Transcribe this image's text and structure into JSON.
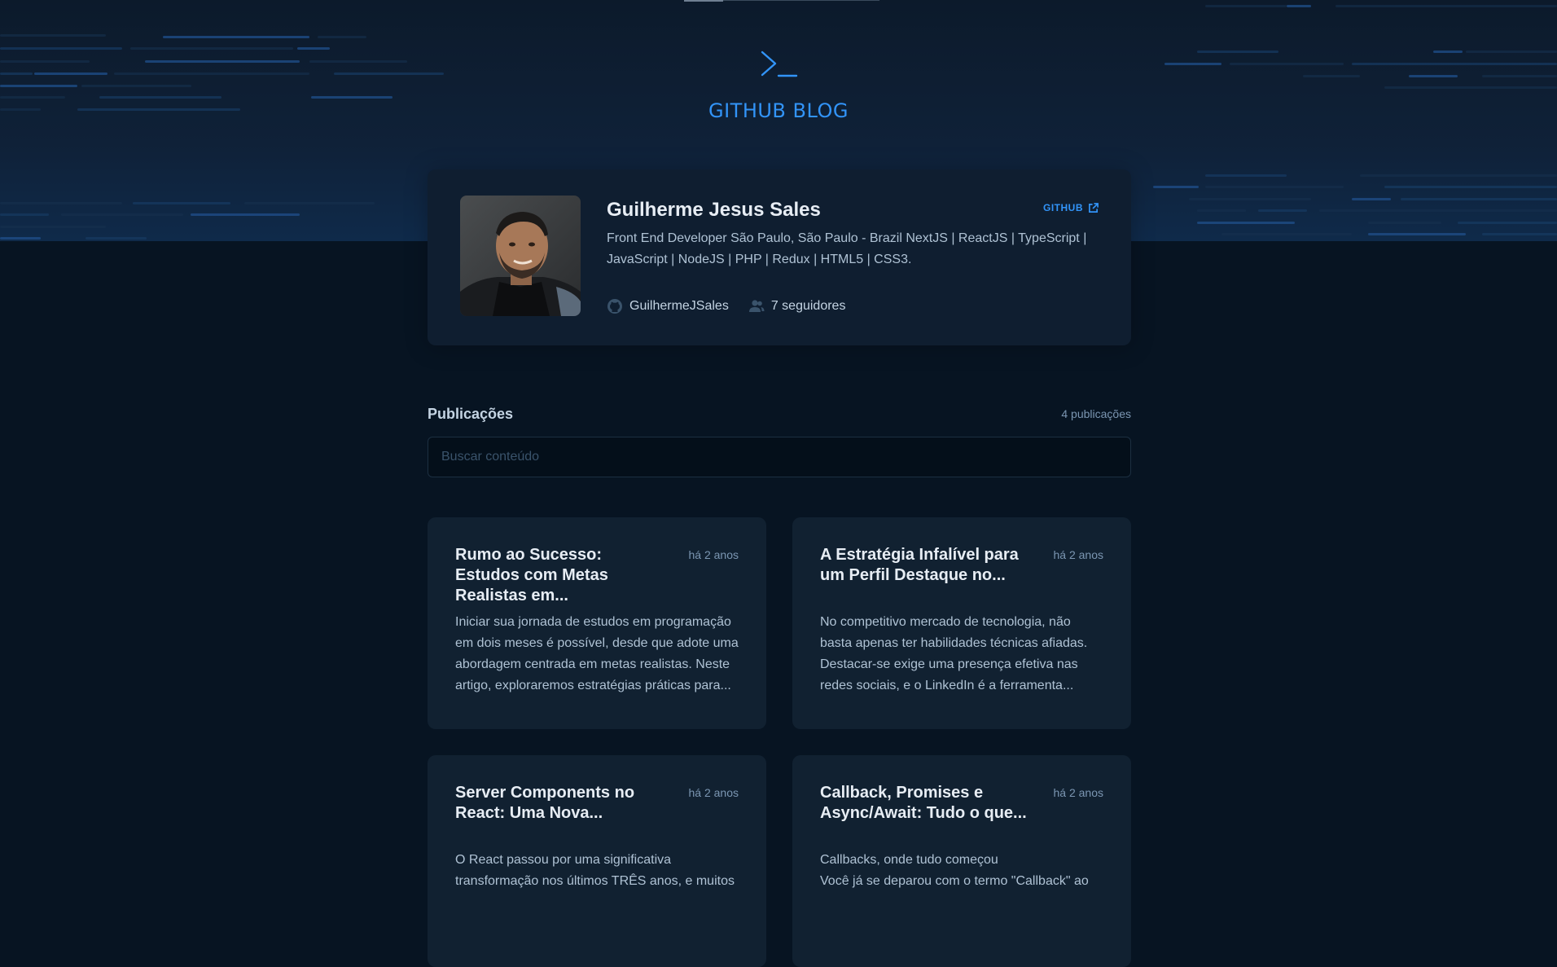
{
  "brand": {
    "name": "GITHUB BLOG"
  },
  "profile": {
    "name": "Guilherme Jesus Sales",
    "github_label": "GITHUB",
    "bio": "Front End Developer São Paulo, São Paulo - Brazil NextJS | ReactJS | TypeScript | JavaScript | NodeJS | PHP | Redux | HTML5 | CSS3.",
    "username": "GuilhermeJSales",
    "followers": "7 seguidores"
  },
  "publications": {
    "title": "Publicações",
    "count": "4 publicações",
    "search_placeholder": "Buscar conteúdo",
    "posts": [
      {
        "title": "Rumo ao Sucesso: Estudos com Metas Realistas em...",
        "date": "há 2 anos",
        "excerpt": "Iniciar sua jornada de estudos em programação em dois meses é possível, desde que adote uma abordagem centrada em metas realistas. Neste artigo, exploraremos estratégias práticas para..."
      },
      {
        "title": "A Estratégia Infalível para um Perfil Destaque no...",
        "date": "há 2 anos",
        "excerpt": "No competitivo mercado de tecnologia, não basta apenas ter habilidades técnicas afiadas. Destacar-se exige uma presença efetiva nas redes sociais, e o LinkedIn é a ferramenta..."
      },
      {
        "title": "Server Components no React: Uma Nova...",
        "date": "há 2 anos",
        "excerpt": "O React passou por uma significativa transformação nos últimos TRÊS anos, e muitos"
      },
      {
        "title": "Callback, Promises e Async/Await: Tudo o que...",
        "date": "há 2 anos",
        "excerpt_line1": "Callbacks, onde tudo começou",
        "excerpt_line2": "Você já se deparou com o termo \"Callback\" ao"
      }
    ]
  },
  "colors": {
    "accent": "#3294f8",
    "background": "#071422",
    "card": "#112131",
    "profile": "#0f1e30"
  }
}
